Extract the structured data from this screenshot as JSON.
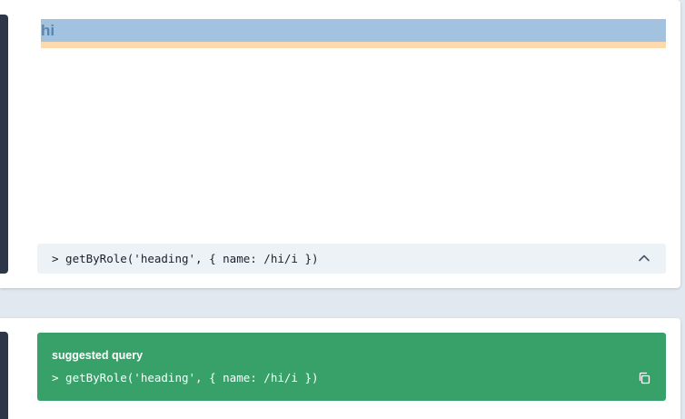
{
  "preview": {
    "heading_text": "hi"
  },
  "query_panel": {
    "query": "> getByRole('heading', { name: /hi/i })",
    "toggle_icon": "chevron-up-icon"
  },
  "suggestion": {
    "title": "suggested query",
    "query": "> getByRole('heading', { name: /hi/i })",
    "copy_icon": "copy-icon"
  },
  "colors": {
    "page_bg": "#e2e8f0",
    "sidebar": "#2d3748",
    "heading_highlight": "#a2c2e0",
    "margin_highlight": "#fdd9ae",
    "query_bg": "#edf2f7",
    "suggestion_bg": "#38a169"
  }
}
